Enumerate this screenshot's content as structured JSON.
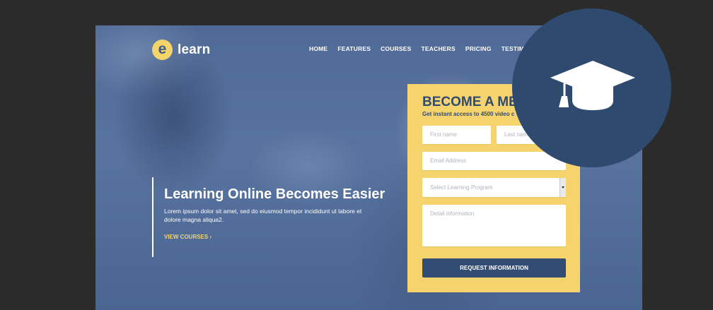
{
  "brand": {
    "mark": "e",
    "name": "learn"
  },
  "nav": {
    "items": [
      "HOME",
      "FEATURES",
      "COURSES",
      "TEACHERS",
      "PRICING",
      "TESTIMONIAL"
    ]
  },
  "hero": {
    "title": "Learning Online Becomes Easier",
    "text": "Lorem ipsum dolor sit amet, sed do eiusmod tempor incididunt ut labore et dolore magna aliqua2.",
    "link": "VIEW COURSES ›"
  },
  "form": {
    "title": "BECOME A MEM",
    "subtitle": "Get instant access to 4500 video c",
    "first_name": "First name",
    "last_name": "Last nam",
    "email": "Email Address",
    "program": "Select Learning Program",
    "details": "Detail information",
    "submit": "REQUEST INFORMATION"
  },
  "badge": {
    "icon": "graduation-cap-icon"
  },
  "colors": {
    "accent": "#f6d46d",
    "primary": "#324d74",
    "badge": "#2f4a6f",
    "page_bg": "#2b2b2b"
  }
}
